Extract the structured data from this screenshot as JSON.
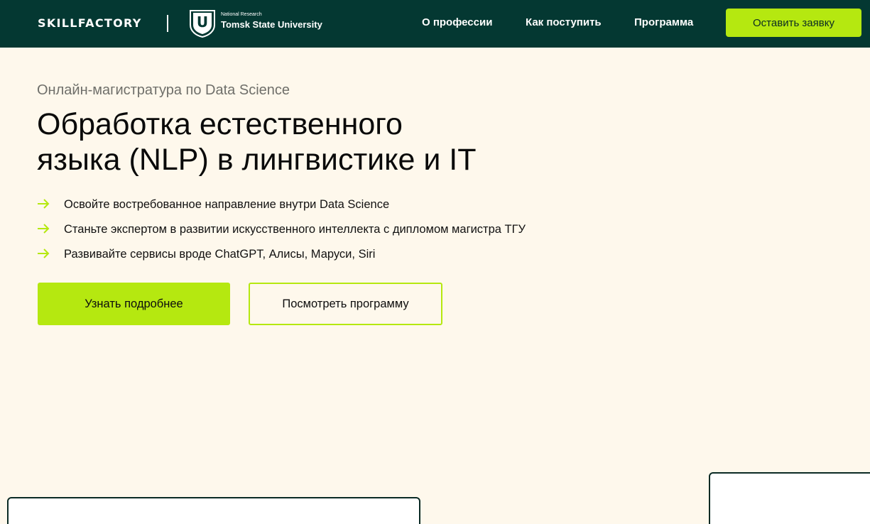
{
  "header": {
    "brand": "SKILLFACTORY",
    "partner_small": "National Research",
    "partner_name": "Tomsk State University",
    "partner_logo_letter": "U",
    "nav": [
      "О профессии",
      "Как поступить",
      "Программа"
    ],
    "cta": "Оставить заявку"
  },
  "hero": {
    "eyebrow": "Онлайн-магистратура по Data Science",
    "title_line1": "Обработка естественного",
    "title_line2": "языка (NLP) в лингвистике и IT",
    "bullets": [
      "Освойте востребованное направление внутри Data Science",
      "Станьте экспертом в развитии искусственного интеллекта с дипломом магистра ТГУ",
      "Развивайте сервисы вроде ChatGPT, Алисы, Маруси, Siri"
    ],
    "bullet_icon": "arrow-right-icon",
    "primary_button": "Узнать подробнее",
    "secondary_button": "Посмотреть программу"
  },
  "colors": {
    "header_bg": "#043832",
    "accent": "#b5e810",
    "page_bg": "#fef8ec",
    "eyebrow": "#6f6f6a"
  }
}
